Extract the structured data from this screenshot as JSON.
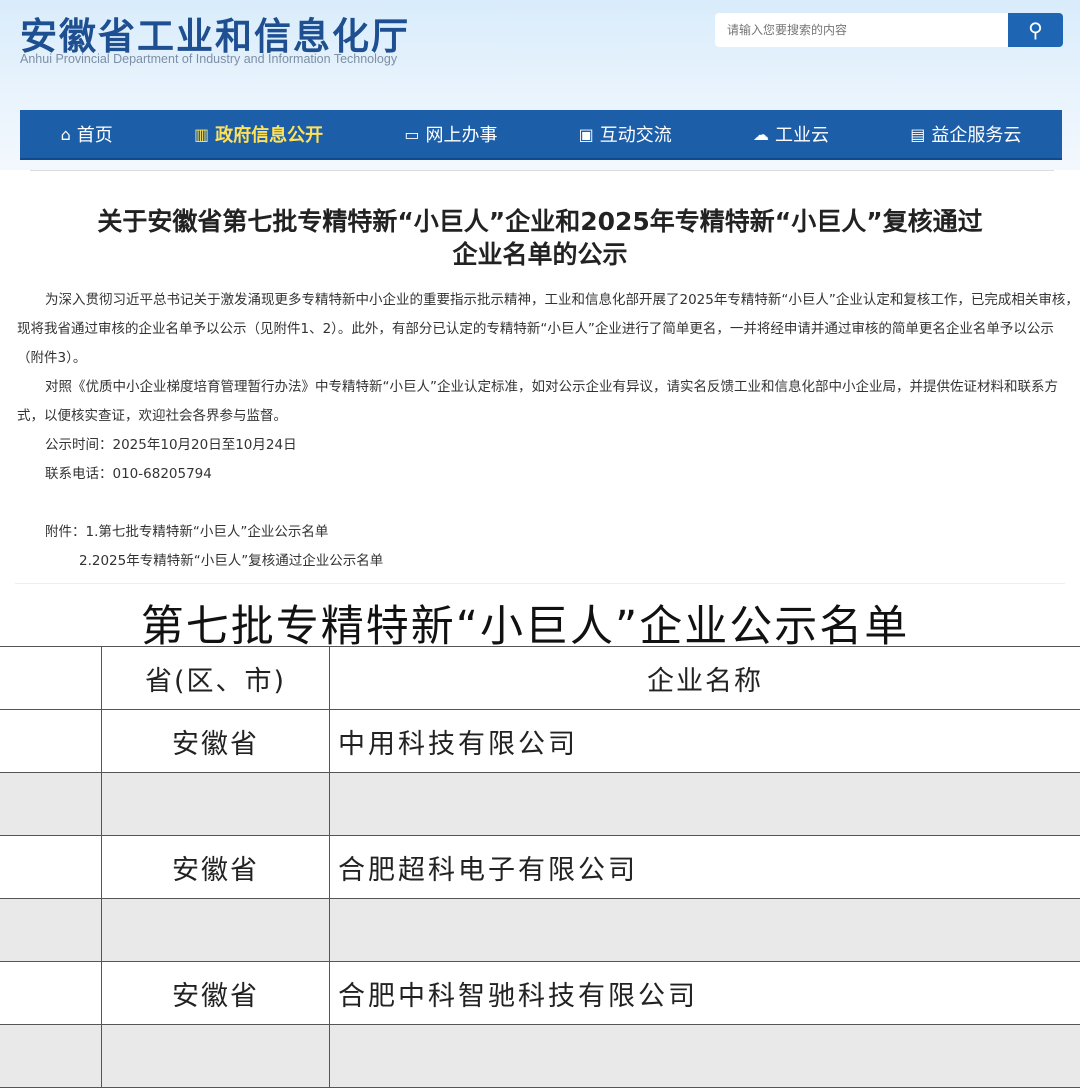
{
  "header": {
    "title": "安徽省工业和信息化厅",
    "subtitle": "Anhui Provincial Department of Industry and Information Technology",
    "search_placeholder": "请输入您要搜索的内容"
  },
  "nav": [
    {
      "label": "首页",
      "icon": "home-icon"
    },
    {
      "label": "政府信息公开",
      "icon": "book-icon",
      "active": true
    },
    {
      "label": "网上办事",
      "icon": "monitor-icon"
    },
    {
      "label": "互动交流",
      "icon": "briefcase-icon"
    },
    {
      "label": "工业云",
      "icon": "cloud-icon"
    },
    {
      "label": "益企服务云",
      "icon": "document-icon"
    }
  ],
  "article": {
    "title_line1": "关于安徽省第七批专精特新“小巨人”企业和2025年专精特新“小巨人”复核通过",
    "title_line2": "企业名单的公示",
    "para1": "为深入贯彻习近平总书记关于激发涌现更多专精特新中小企业的重要指示批示精神，工业和信息化部开展了2025年专精特新“小巨人”企业认定和复核工作，已完成相关审核，现将我省通过审核的企业名单予以公示（见附件1、2）。此外，有部分已认定的专精特新“小巨人”企业进行了简单更名，一并将经申请并通过审核的简单更名企业名单予以公示（附件3）。",
    "para2": "对照《优质中小企业梯度培育管理暂行办法》中专精特新“小巨人”企业认定标准，如对公示企业有异议，请实名反馈工业和信息化部中小企业局，并提供佐证材料和联系方式，以便核实查证，欢迎社会各界参与监督。",
    "period": "公示时间：2025年10月20日至10月24日",
    "phone": "联系电话：010-68205794",
    "attachment1": "附件：1.第七批专精特新“小巨人”企业公示名单",
    "attachment2": "2.2025年专精特新“小巨人”复核通过企业公示名单"
  },
  "list": {
    "title": "第七批专精特新“小巨人”企业公示名单",
    "headers": [
      "",
      "省(区、市)",
      "企业名称"
    ],
    "rows": [
      [
        "",
        "安徽省",
        "中用科技有限公司"
      ],
      [
        "",
        "",
        ""
      ],
      [
        "",
        "安徽省",
        "合肥超科电子有限公司"
      ],
      [
        "",
        "",
        ""
      ],
      [
        "",
        "安徽省",
        "合肥中科智驰科技有限公司"
      ],
      [
        "",
        "",
        ""
      ]
    ]
  }
}
